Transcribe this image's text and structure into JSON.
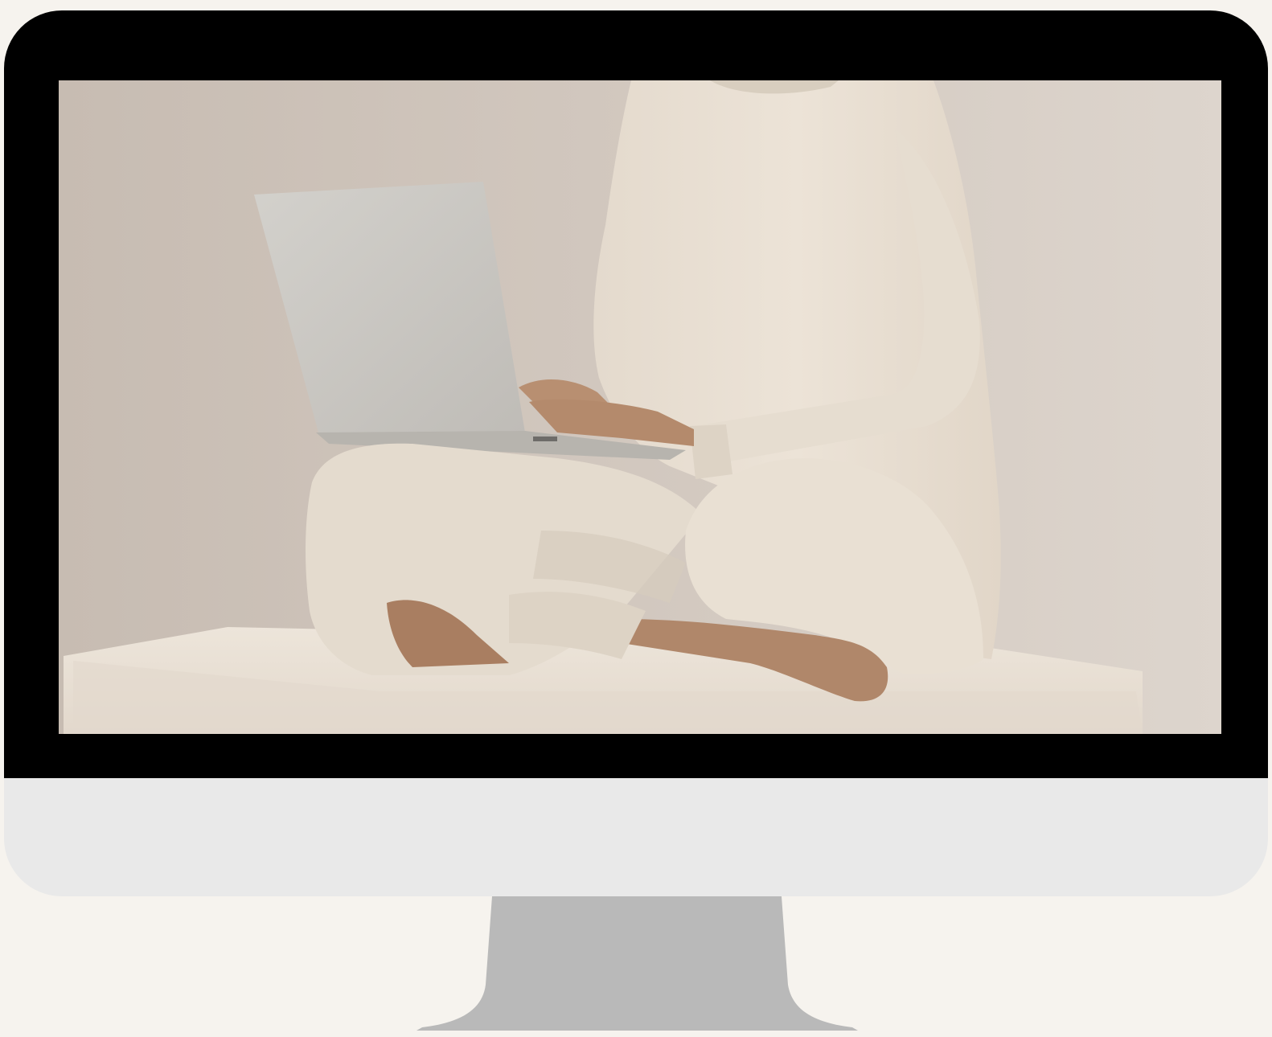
{
  "page": {
    "background": "#f6f3ee"
  },
  "monitor": {
    "bezel_color": "#000000",
    "chin_color": "#e9e9e9",
    "stand_color": "#b9b9b9"
  },
  "screen_image": {
    "palette": {
      "wall": "#cdc3b9",
      "sweater": "#e8dfd2",
      "pants": "#e6ddd0",
      "skin": "#b48a6c",
      "laptop": "#c9c7c2",
      "block": "#ece4d9"
    }
  }
}
